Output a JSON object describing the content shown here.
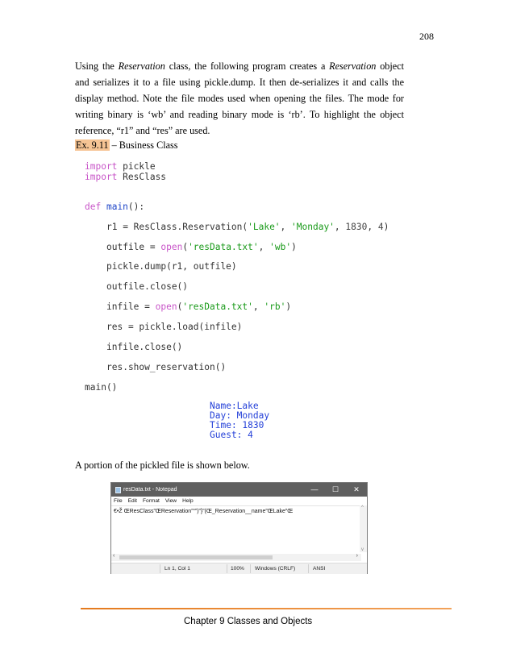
{
  "page_number": "208",
  "intro": {
    "t1": "Using the ",
    "em1": "Reservation",
    "t2": " class, the following program creates a ",
    "em2": "Reservation",
    "t3": " object and serializes it to a file using pickle.dump.  It then de-serializes it and calls the display method.  Note the file modes used when opening the files.  The mode for writing binary is ‘wb’ and reading binary mode is ‘rb’.  To highlight the object reference, “r1” and “res” are used."
  },
  "example": {
    "tag": "Ex. 9.11",
    "title": " – Business Class"
  },
  "code": {
    "import1_kw": "import",
    "import1_mod": " pickle",
    "import2_kw": "import",
    "import2_mod": " ResClass",
    "def_kw": "def",
    "def_name": "main",
    "def_rest": "():",
    "l1_a": "r1 = ResClass.Reservation(",
    "l1_s1": "'Lake'",
    "l1_c1": ", ",
    "l1_s2": "'Monday'",
    "l1_c2": ", ",
    "l1_n1": "1830",
    "l1_c3": ", ",
    "l1_n2": "4",
    "l1_e": ")",
    "l2_a": "outfile = ",
    "l2_fn": "open",
    "l2_p": "(",
    "l2_s1": "'resData.txt'",
    "l2_c": ", ",
    "l2_s2": "'wb'",
    "l2_e": ")",
    "l3": "pickle.dump(r1, outfile)",
    "l4": "outfile.close()",
    "l5_a": "infile = ",
    "l5_fn": "open",
    "l5_p": "(",
    "l5_s1": "'resData.txt'",
    "l5_c": ", ",
    "l5_s2": "'rb'",
    "l5_e": ")",
    "l6": "res = pickle.load(infile)",
    "l7": "infile.close()",
    "l8": "res.show_reservation()",
    "call": "main()"
  },
  "output": [
    "Name:Lake",
    "Day: Monday",
    "Time: 1830",
    "Guest: 4"
  ],
  "portion_text": "A portion of the pickled file is shown below.",
  "notepad": {
    "title": "resData.txt - Notepad",
    "window_buttons": [
      "—",
      "☐",
      "✕"
    ],
    "menu": [
      "File",
      "Edit",
      "Format",
      "View",
      "Help"
    ],
    "content": "€•Ž      Œ\bResClass”Œ\u000bReservation”“”)”}”(Œ\u0013_Reservation__name”Œ\u0004Lake”Œ",
    "status": {
      "position": "Ln 1, Col 1",
      "zoom": "100%",
      "line_ending": "Windows (CRLF)",
      "encoding": "ANSI"
    }
  },
  "footer": "Chapter 9 Classes and Objects",
  "colors": {
    "highlight": "#f6c494",
    "keyword": "#c855c8",
    "function": "#1f46c8",
    "string": "#1a9a1a",
    "output": "#2440d8",
    "footer_rule": "#e47a1d"
  }
}
